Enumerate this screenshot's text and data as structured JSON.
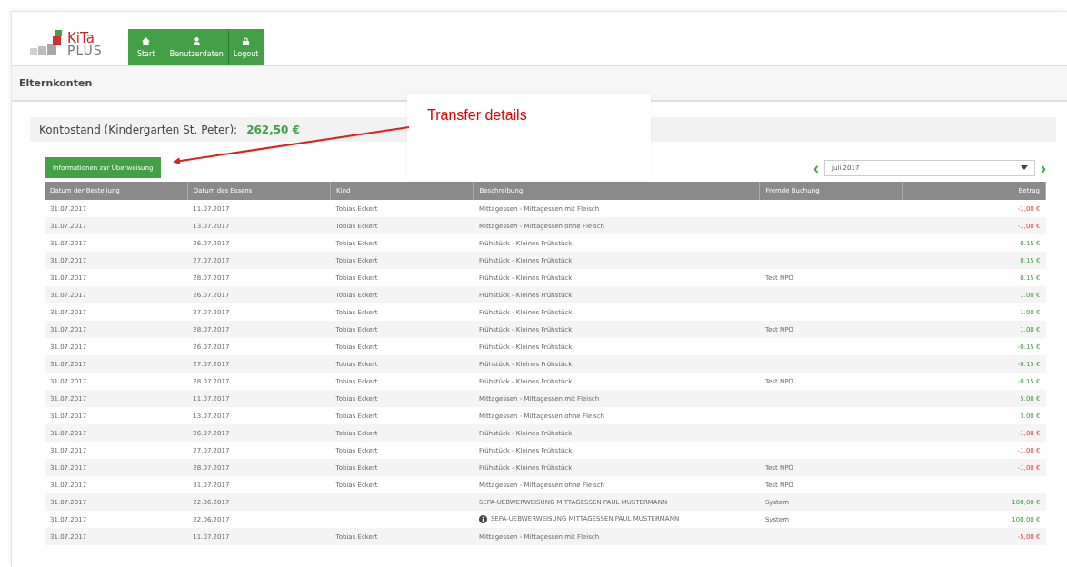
{
  "logo": {
    "line_1": "KiTa",
    "line_2": "PLUS"
  },
  "nav": [
    {
      "label": "Start"
    },
    {
      "label": "Benutzerdaten"
    },
    {
      "label": "Logout"
    }
  ],
  "page_title": "Elternkonten",
  "balance": {
    "label": "Kontostand (Kindergarten St. Peter):",
    "value": "262,50 €"
  },
  "transfer_button": "Informationen zur Überweisung",
  "month_select": {
    "prev": "‹",
    "value": "Juli 2017",
    "next": "›"
  },
  "annotation": {
    "text": "Transfer details"
  },
  "table": {
    "columns": [
      "Datum der Bestellung",
      "Datum des Essens",
      "Kind",
      "Beschreibung",
      "Fremde Buchung",
      "Betrag"
    ],
    "rows": [
      {
        "cells": [
          "31.07.2017",
          "11.07.2017",
          "Tobias Eckert",
          "Mittagessen - Mittagessen mit Fleisch",
          "",
          "-1,00 €"
        ],
        "kind": "debit",
        "info": false
      },
      {
        "cells": [
          "31.07.2017",
          "13.07.2017",
          "Tobias Eckert",
          "Mittagessen - Mittagessen ohne Fleisch",
          "",
          "-1,00 €"
        ],
        "kind": "debit",
        "info": false
      },
      {
        "cells": [
          "31.07.2017",
          "26.07.2017",
          "Tobias Eckert",
          "Frühstück - Kleines Frühstück",
          "",
          "0.15 €"
        ],
        "kind": "credit",
        "info": false
      },
      {
        "cells": [
          "31.07.2017",
          "27.07.2017",
          "Tobias Eckert",
          "Frühstück - Kleines Frühstück",
          "",
          "0.15 €"
        ],
        "kind": "credit",
        "info": false
      },
      {
        "cells": [
          "31.07.2017",
          "28.07.2017",
          "Tobias Eckert",
          "Frühstück - Kleines Frühstück",
          "Test NPO",
          "0.15 €"
        ],
        "kind": "credit",
        "info": false
      },
      {
        "cells": [
          "31.07.2017",
          "26.07.2017",
          "Tobias Eckert",
          "Frühstück - Kleines Frühstück",
          "",
          "1.00 €"
        ],
        "kind": "credit",
        "info": false
      },
      {
        "cells": [
          "31.07.2017",
          "27.07.2017",
          "Tobias Eckert",
          "Frühstück - Kleines Frühstück",
          "",
          "1.00 €"
        ],
        "kind": "credit",
        "info": false
      },
      {
        "cells": [
          "31.07.2017",
          "28.07.2017",
          "Tobias Eckert",
          "Frühstück - Kleines Frühstück",
          "Test NPO",
          "1.00 €"
        ],
        "kind": "credit",
        "info": false
      },
      {
        "cells": [
          "31.07.2017",
          "26.07.2017",
          "Tobias Eckert",
          "Frühstück - Kleines Frühstück",
          "",
          "-0.15 €"
        ],
        "kind": "credit",
        "info": false
      },
      {
        "cells": [
          "31.07.2017",
          "27.07.2017",
          "Tobias Eckert",
          "Frühstück - Kleines Frühstück",
          "",
          "-0.15 €"
        ],
        "kind": "credit",
        "info": false
      },
      {
        "cells": [
          "31.07.2017",
          "28.07.2017",
          "Tobias Eckert",
          "Frühstück - Kleines Frühstück",
          "Test NPO",
          "-0.15 €"
        ],
        "kind": "credit",
        "info": false
      },
      {
        "cells": [
          "31.07.2017",
          "11.07.2017",
          "Tobias Eckert",
          "Mittagessen - Mittagessen mit Fleisch",
          "",
          "5.00 €"
        ],
        "kind": "credit",
        "info": false
      },
      {
        "cells": [
          "31.07.2017",
          "13.07.2017",
          "Tobias Eckert",
          "Mittagessen - Mittagessen ohne Fleisch",
          "",
          "3.00 €"
        ],
        "kind": "credit",
        "info": false
      },
      {
        "cells": [
          "31.07.2017",
          "26.07.2017",
          "Tobias Eckert",
          "Frühstück - Kleines Frühstück",
          "",
          "-1,00 €"
        ],
        "kind": "debit",
        "info": false
      },
      {
        "cells": [
          "31.07.2017",
          "27.07.2017",
          "Tobias Eckert",
          "Frühstück - Kleines Frühstück",
          "",
          "-1,00 €"
        ],
        "kind": "debit",
        "info": false
      },
      {
        "cells": [
          "31.07.2017",
          "28.07.2017",
          "Tobias Eckert",
          "Frühstück - Kleines Frühstück",
          "Test NPO",
          "-1,00 €"
        ],
        "kind": "debit",
        "info": false
      },
      {
        "cells": [
          "31.07.2017",
          "31.07.2017",
          "Tobias Eckert",
          "Mittagessen - Mittagessen ohne Fleisch",
          "Test NPO",
          ""
        ],
        "info": false
      },
      {
        "cells": [
          "31.07.2017",
          "22.06.2017",
          "",
          "SEPA-UEBWERWEISUNG MITTAGESSEN PAUL MUSTERMANN",
          "System",
          "100,00 €"
        ],
        "kind": "credit",
        "info": false
      },
      {
        "cells": [
          "31.07.2017",
          "22.06.2017",
          "",
          "SEPA-UEBWERWEISUNG MITTAGESSEN PAUL MUSTERMANN",
          "System",
          "100,00 €"
        ],
        "kind": "credit",
        "info": true
      },
      {
        "cells": [
          "31.07.2017",
          "11.07.2017",
          "Tobias Eckert",
          "Mittagessen - Mittagessen mit Fleisch",
          "",
          "-5,00 €"
        ],
        "kind": "debit",
        "info": false
      }
    ]
  }
}
